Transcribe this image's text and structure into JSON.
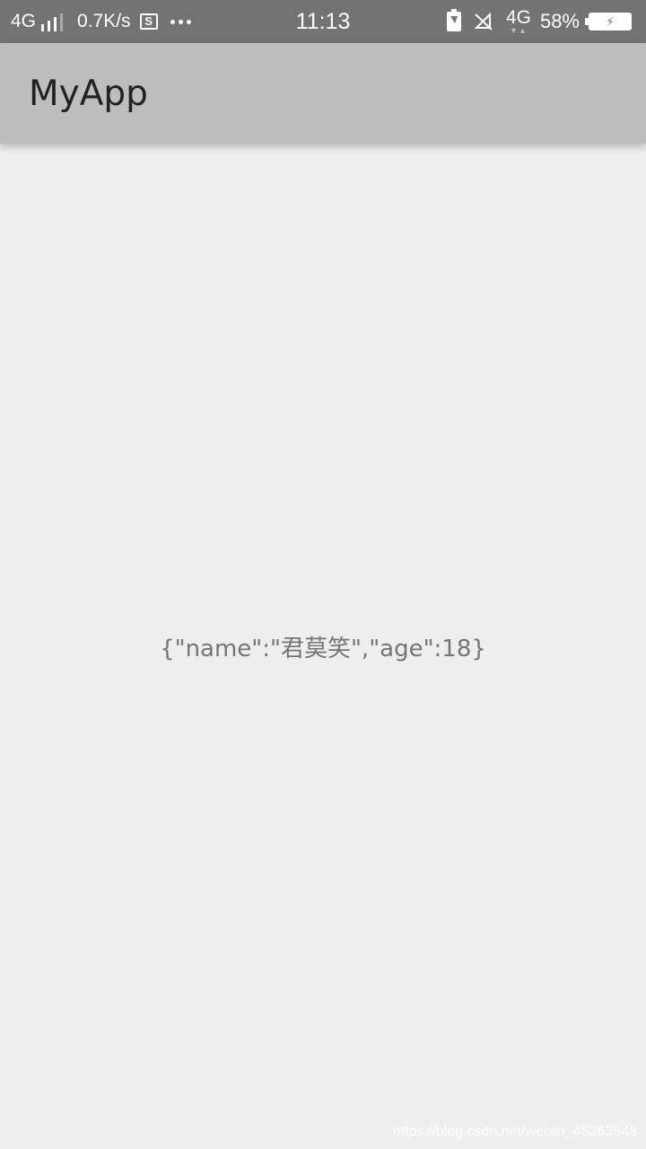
{
  "status_bar": {
    "network_type_left": "4G",
    "speed": "0.7K/s",
    "screenshot_letter": "S",
    "time": "11:13",
    "network_type_right": "4G",
    "battery_percent": "58%",
    "icons": [
      "signal-bars-icon",
      "screenshot-icon",
      "more-dots-icon",
      "battery-saver-icon",
      "mute-icon",
      "battery-charging-icon"
    ]
  },
  "app_bar": {
    "title": "MyApp"
  },
  "main": {
    "json_text": "{\"name\":\"君莫笑\",\"age\":18}"
  },
  "watermark": {
    "text": "https://blog.csdn.net/weixin_45263548"
  },
  "colors": {
    "status_bar_bg": "#737373",
    "app_bar_bg": "#bdbdbd",
    "content_bg": "#eeeeee",
    "body_text": "#757575"
  }
}
